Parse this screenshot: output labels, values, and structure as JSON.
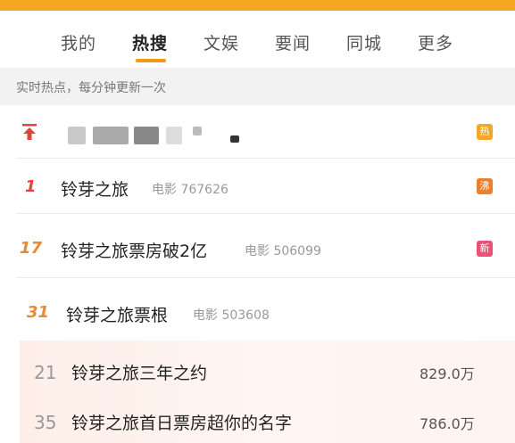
{
  "colors": {
    "accent": "#f39c12",
    "hot_badge": "#f5a623",
    "boil_badge": "#ef7d2a",
    "new_badge": "#ef4f73"
  },
  "tabs": [
    {
      "label": "我的"
    },
    {
      "label": "热搜"
    },
    {
      "label": "文娱"
    },
    {
      "label": "要闻"
    },
    {
      "label": "同城"
    },
    {
      "label": "更多"
    }
  ],
  "active_tab": "热搜",
  "subheader": "实时热点，每分钟更新一次",
  "pinned": {
    "icon": "pin-top-icon",
    "badge": "热"
  },
  "hot_list": [
    {
      "rank": "1",
      "title": "铃芽之旅",
      "meta": "电影 767626",
      "badge": "沸"
    },
    {
      "rank": "17",
      "title": "铃芽之旅票房破2亿",
      "meta": "电影 506099",
      "badge": "新"
    },
    {
      "rank": "31",
      "title": "铃芽之旅票根",
      "meta": "电影 503608",
      "badge": ""
    }
  ],
  "related": [
    {
      "rank": "21",
      "title": "铃芽之旅三年之约",
      "count": "829.0万"
    },
    {
      "rank": "35",
      "title": "铃芽之旅首日票房超你的名字",
      "count": "786.0万"
    }
  ]
}
